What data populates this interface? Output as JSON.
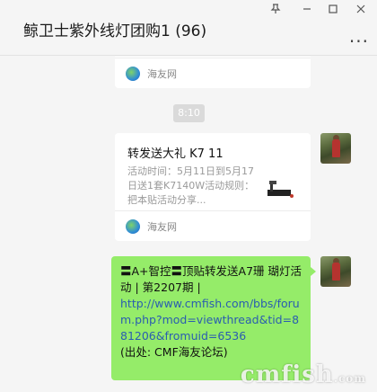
{
  "header": {
    "title": "鲸卫士紫外线灯团购1 (96)",
    "pin_icon": "pin-icon",
    "minimize_icon": "minimize-icon",
    "maximize_icon": "maximize-icon",
    "close_icon": "close-icon",
    "more_label": "..."
  },
  "messages": {
    "top_card": {
      "source": "海友网"
    },
    "time_divider": "8:10",
    "link_card": {
      "title": "转发送大礼 K7 11",
      "description": "活动时间：5月11日到5月17日送1套K7140W活动规则：把本贴活动分享...",
      "source": "海友网"
    },
    "text_bubble": {
      "line1": "〓A+智控〓顶贴转发送A7珊 瑚灯活动 | 第2207期 |",
      "url": "http://www.cmfish.com/bbs/forum.php?mod=viewthread&tid=881206&fromuid=6536",
      "source_note": "(出处: CMF海友论坛)"
    }
  },
  "watermark": {
    "text": "cmfish",
    "suffix": ".com"
  }
}
